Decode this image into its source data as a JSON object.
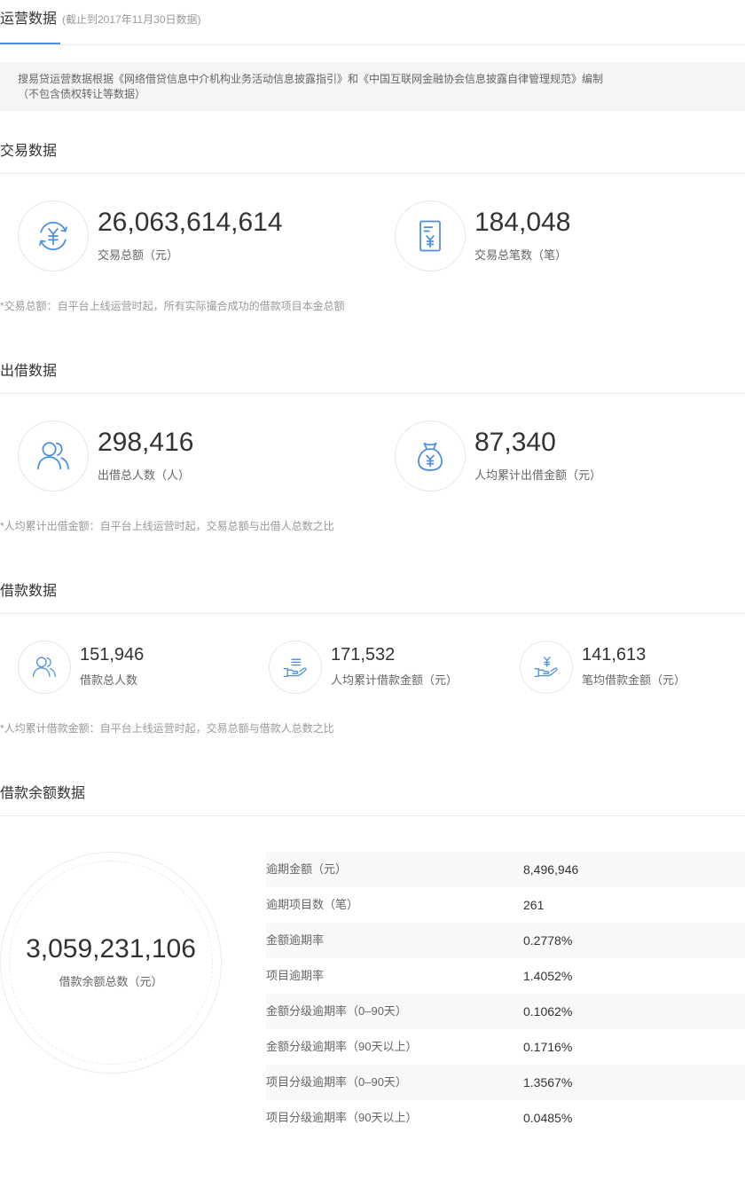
{
  "header": {
    "tab_title": "运营数据",
    "tab_subtitle": "(截止到2017年11月30日数据)"
  },
  "notice": {
    "line1": "搜易贷运营数据根据《网络借贷信息中介机构业务活动信息披露指引》和《中国互联网金融协会信息披露自律管理规范》编制",
    "line2": "（不包含债权转让等数据）"
  },
  "transaction": {
    "title": "交易数据",
    "stats": [
      {
        "value": "26,063,614,614",
        "label": "交易总额（元）",
        "icon": "exchange-yen-icon"
      },
      {
        "value": "184,048",
        "label": "交易总笔数（笔）",
        "icon": "document-yen-icon"
      }
    ],
    "note": "*交易总额：自平台上线运营时起，所有实际撮合成功的借款项目本金总额"
  },
  "lending": {
    "title": "出借数据",
    "stats": [
      {
        "value": "298,416",
        "label": "出借总人数（人）",
        "icon": "people-icon"
      },
      {
        "value": "87,340",
        "label": "人均累计出借金额（元）",
        "icon": "money-bag-icon"
      }
    ],
    "note": "*人均累计出借金额：自平台上线运营时起，交易总额与出借人总数之比"
  },
  "borrowing": {
    "title": "借款数据",
    "stats": [
      {
        "value": "151,946",
        "label": "借款总人数",
        "icon": "people-icon"
      },
      {
        "value": "171,532",
        "label": "人均累计借款金额（元）",
        "icon": "hand-document-icon"
      },
      {
        "value": "141,613",
        "label": "笔均借款金额（元）",
        "icon": "hand-yen-icon"
      }
    ],
    "note": "*人均累计借款金额：自平台上线运营时起，交易总额与借款人总数之比"
  },
  "balance": {
    "title": "借款余额数据",
    "total_value": "3,059,231,106",
    "total_label": "借款余额总数（元）",
    "rows": [
      {
        "label": "逾期金额（元）",
        "value": "8,496,946"
      },
      {
        "label": "逾期项目数（笔）",
        "value": "261"
      },
      {
        "label": "金额逾期率",
        "value": "0.2778%"
      },
      {
        "label": "项目逾期率",
        "value": "1.4052%"
      },
      {
        "label": "金额分级逾期率（0–90天）",
        "value": "0.1062%"
      },
      {
        "label": "金额分级逾期率（90天以上）",
        "value": "0.1716%"
      },
      {
        "label": "项目分级逾期率（0–90天）",
        "value": "1.3567%"
      },
      {
        "label": "项目分级逾期率（90天以上）",
        "value": "0.0485%"
      }
    ]
  },
  "colors": {
    "accent": "#4a8fe3",
    "notice_bg": "#f5f5f5",
    "row_stripe": "#f8f8f8"
  }
}
